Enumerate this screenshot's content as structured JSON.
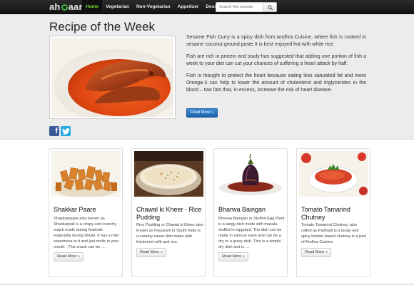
{
  "brand": {
    "name_part1": "ah",
    "name_part2": "aar"
  },
  "nav": {
    "items": [
      {
        "label": "Home",
        "active": true
      },
      {
        "label": "Vegetarian",
        "active": false
      },
      {
        "label": "Non-Vegetarian",
        "active": false
      },
      {
        "label": "Appetizer",
        "active": false
      },
      {
        "label": "Dessert",
        "active": false
      }
    ]
  },
  "search": {
    "placeholder": "Search this website",
    "icon": "search-icon"
  },
  "hero": {
    "title": "Recipe of the Week",
    "image": "fish-curry-photo",
    "paragraphs": [
      "Sesame Fish Curry is a spicy dish from Andhra Cuisine, where fish is cooked in sesame coconut ground paste.It is best enjoyed hot with white rice.",
      "Fish are rich in protein and study has suggested that adding one portion of fish a week to your diet can cut your chances of suffering a heart attack by half.",
      "Fish is thought to protect the heart because eating less saturated fat and more Omega-3 can help to lower the amount of cholesterol and triglycerides in the blood – two fats that, in excess, increase the risk of heart disease."
    ],
    "read_more": "Read More »",
    "social": {
      "facebook": "f",
      "twitter_icon": "twitter-icon"
    }
  },
  "cards": [
    {
      "title": "Shakkar Paare",
      "image": "shakkar-paare-photo",
      "desc": "Shakkarpaare also known as Shankarpali is a crispy and crunchy snack made during festivals especially during Diwali. It has a mild sweetness to it and just melts in your mouth . This snack can be ....",
      "read_more": "Read More »"
    },
    {
      "title": "Chawal ki Kheer - Rice Pudding",
      "image": "rice-pudding-photo",
      "desc": "Rice Pudding or Chawal ki Kheer also known as Payasam in South India is a creamy sweet dish made with thickened milk and rice.",
      "read_more": "Read More »"
    },
    {
      "title": "Bharwa Baingan",
      "image": "stuffed-eggplant-photo",
      "desc": "Bharwa Baingan or Stuffed Egg Plant is a tangy dish made with masala stuffed in eggplant. The dish can be made in various ways and can be a dry or a gravy dish. This is a simple dry dish and is ....",
      "read_more": "Read More »"
    },
    {
      "title": "Tomato Tamarind Chutney",
      "image": "tomato-chutney-photo",
      "desc": "Tomato Tamarind Chutney, also called as Padhadi is a tangy and spicy tomato based chutney is a part of Andhra Cuisine.",
      "read_more": "Read More »"
    }
  ],
  "colors": {
    "nav_active": "#7ddc3c",
    "primary": "#1d61a9",
    "hero_bg": "#ececec"
  }
}
